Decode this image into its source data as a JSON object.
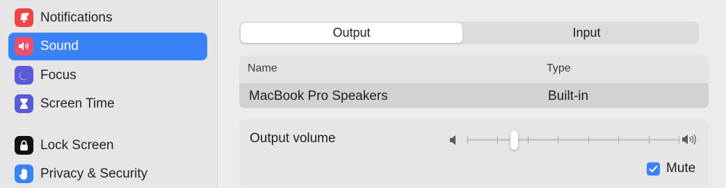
{
  "sidebar": {
    "items": [
      {
        "label": "Notifications",
        "icon": "bell-icon",
        "color": "#ef4444",
        "selected": false
      },
      {
        "label": "Sound",
        "icon": "speaker-icon",
        "color": "#ec4e6b",
        "selected": true
      },
      {
        "label": "Focus",
        "icon": "moon-icon",
        "color": "#5a5bd6",
        "selected": false
      },
      {
        "label": "Screen Time",
        "icon": "hourglass-icon",
        "color": "#5a5bd6",
        "selected": false
      },
      {
        "label": "Lock Screen",
        "icon": "lock-icon",
        "color": "#111111",
        "selected": false
      },
      {
        "label": "Privacy & Security",
        "icon": "hand-icon",
        "color": "#3b82f6",
        "selected": false
      }
    ]
  },
  "main": {
    "tabs": [
      {
        "label": "Output",
        "active": true
      },
      {
        "label": "Input",
        "active": false
      }
    ],
    "table": {
      "headers": {
        "name": "Name",
        "type": "Type"
      },
      "rows": [
        {
          "name": "MacBook Pro Speakers",
          "type": "Built-in",
          "selected": true
        }
      ]
    },
    "output_volume": {
      "label": "Output volume",
      "value_fraction": 0.22,
      "ticks": 8
    },
    "mute": {
      "label": "Mute",
      "checked": true
    }
  },
  "colors": {
    "accent": "#3b82f6",
    "sidebar_bg": "#e6e6e6",
    "main_bg": "#ececec"
  }
}
